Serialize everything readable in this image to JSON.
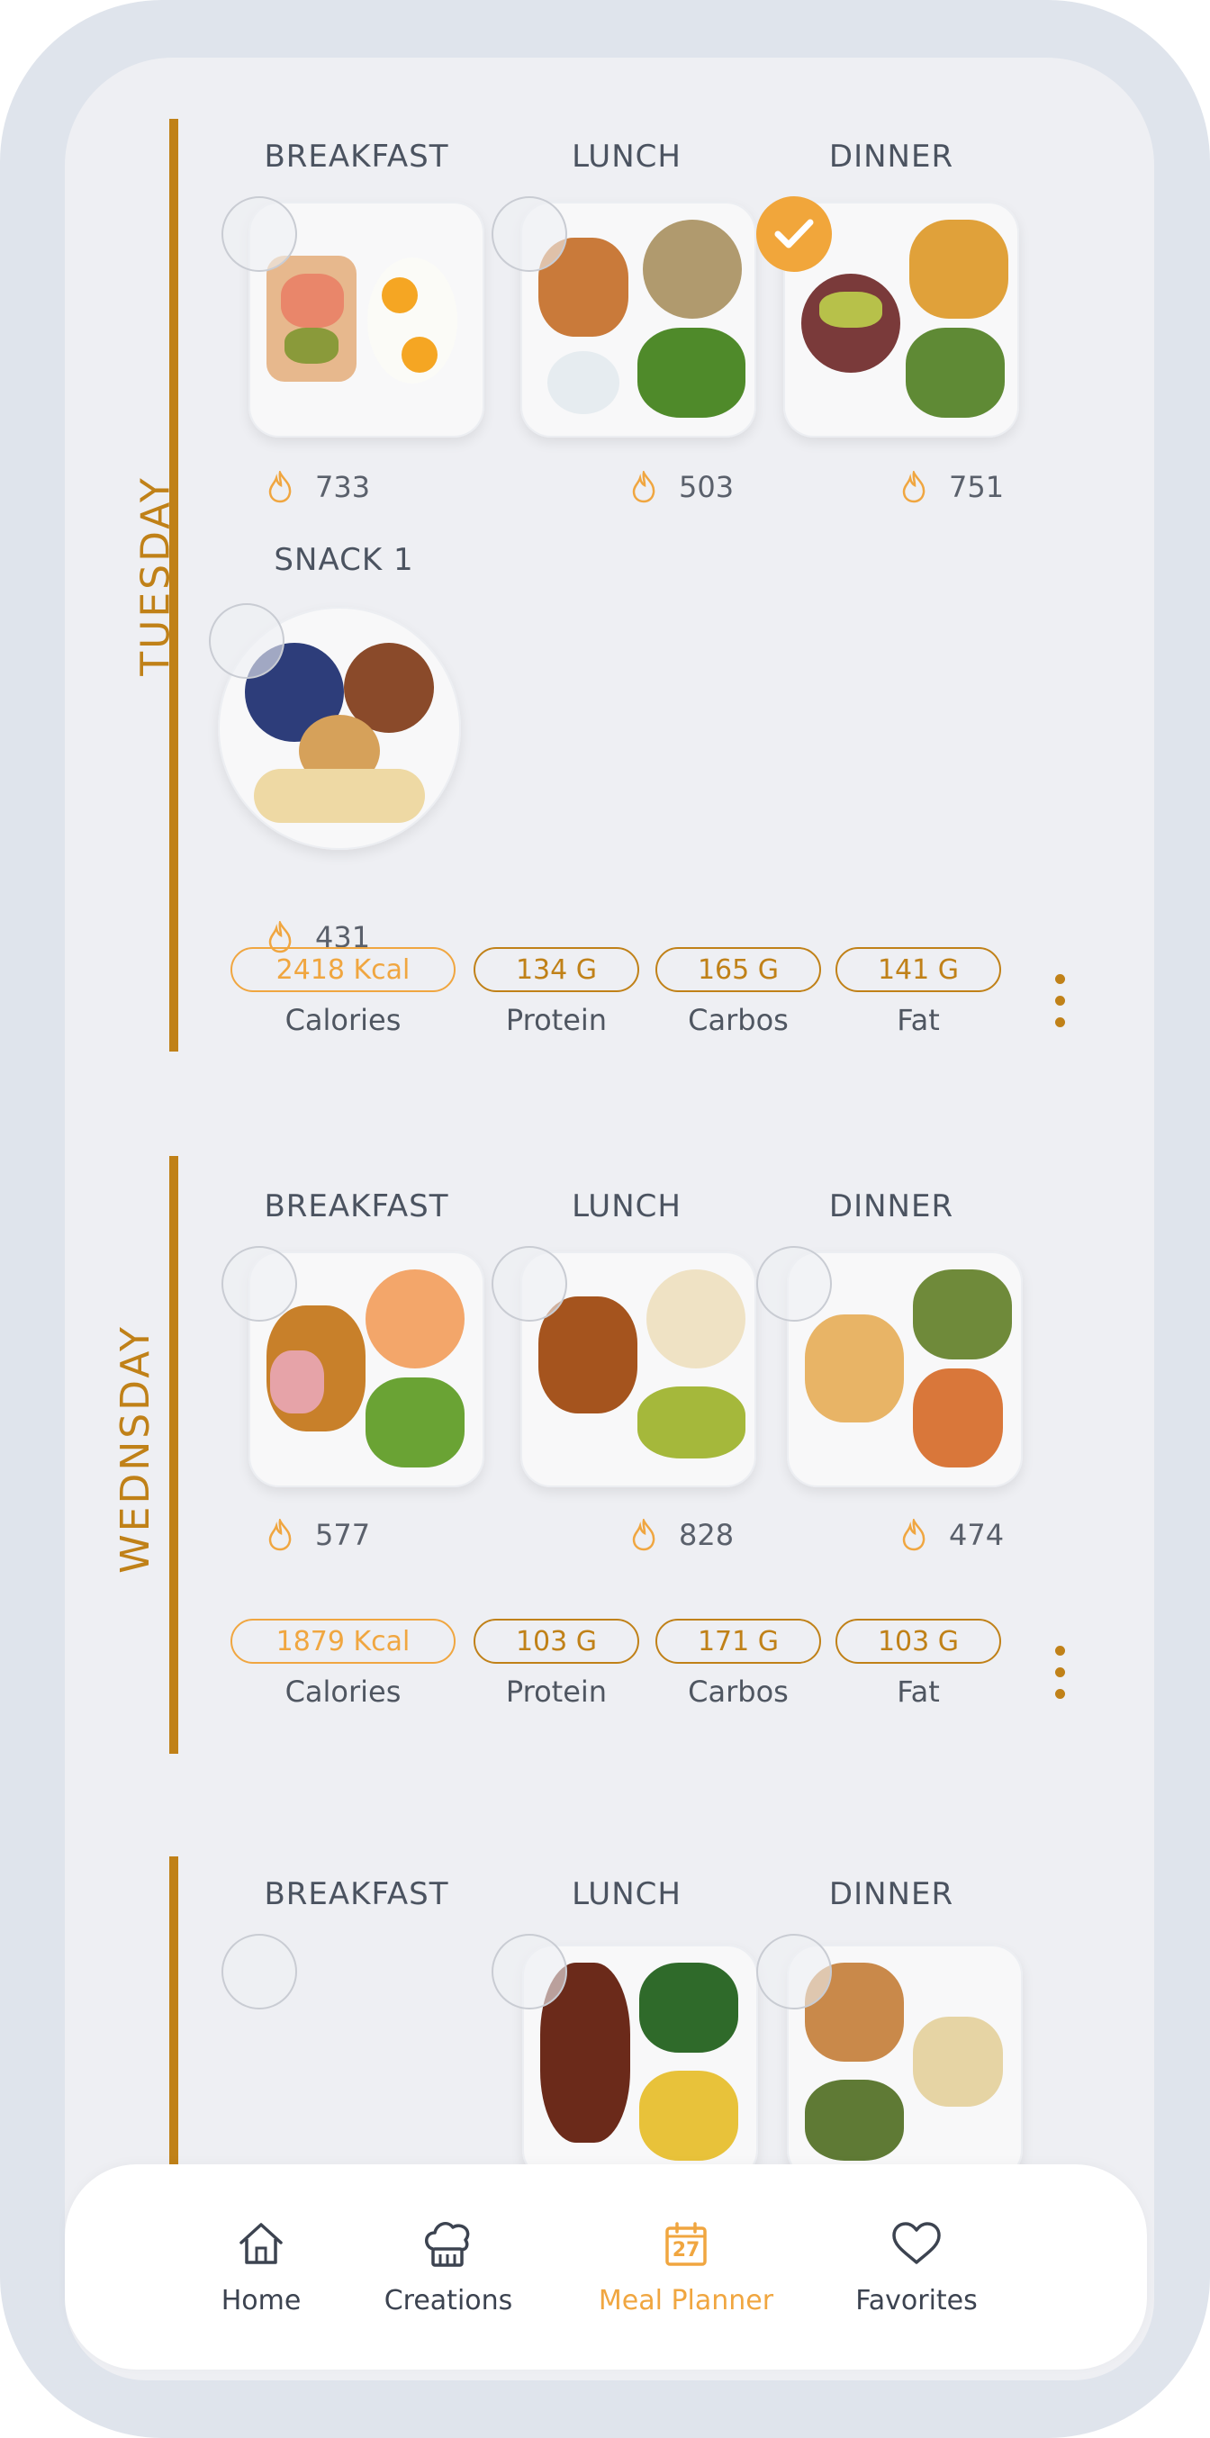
{
  "days": [
    {
      "name": "TUESDAY",
      "meals": [
        {
          "title": "BREAKFAST",
          "kcal": "733",
          "checked": false
        },
        {
          "title": "LUNCH",
          "kcal": "503",
          "checked": false
        },
        {
          "title": "DINNER",
          "kcal": "751",
          "checked": true
        },
        {
          "title": "SNACK 1",
          "kcal": "431",
          "checked": false
        }
      ],
      "totals": {
        "calories": "2418 Kcal",
        "calories_label": "Calories",
        "protein": "134 G",
        "protein_label": "Protein",
        "carbos": "165 G",
        "carbos_label": "Carbos",
        "fat": "141 G",
        "fat_label": "Fat"
      }
    },
    {
      "name": "WEDNSDAY",
      "meals": [
        {
          "title": "BREAKFAST",
          "kcal": "577",
          "checked": false
        },
        {
          "title": "LUNCH",
          "kcal": "828",
          "checked": false
        },
        {
          "title": "DINNER",
          "kcal": "474",
          "checked": false
        }
      ],
      "totals": {
        "calories": "1879 Kcal",
        "calories_label": "Calories",
        "protein": "103 G",
        "protein_label": "Protein",
        "carbos": "171 G",
        "carbos_label": "Carbos",
        "fat": "103 G",
        "fat_label": "Fat"
      }
    },
    {
      "name": "",
      "meals": [
        {
          "title": "BREAKFAST",
          "checked": false
        },
        {
          "title": "LUNCH",
          "checked": false
        },
        {
          "title": "DINNER",
          "checked": false
        }
      ]
    }
  ],
  "nav": {
    "home": "Home",
    "creations": "Creations",
    "planner": "Meal Planner",
    "planner_date": "27",
    "favorites": "Favorites"
  },
  "colors": {
    "accent": "#c08118",
    "accent_light": "#f0a640",
    "background": "#eeeff3",
    "frame": "#dfe4ec"
  },
  "icons": [
    "flame-icon",
    "check-icon",
    "home-icon",
    "chef-hat-icon",
    "calendar-icon",
    "heart-icon",
    "more-vertical-icon"
  ]
}
